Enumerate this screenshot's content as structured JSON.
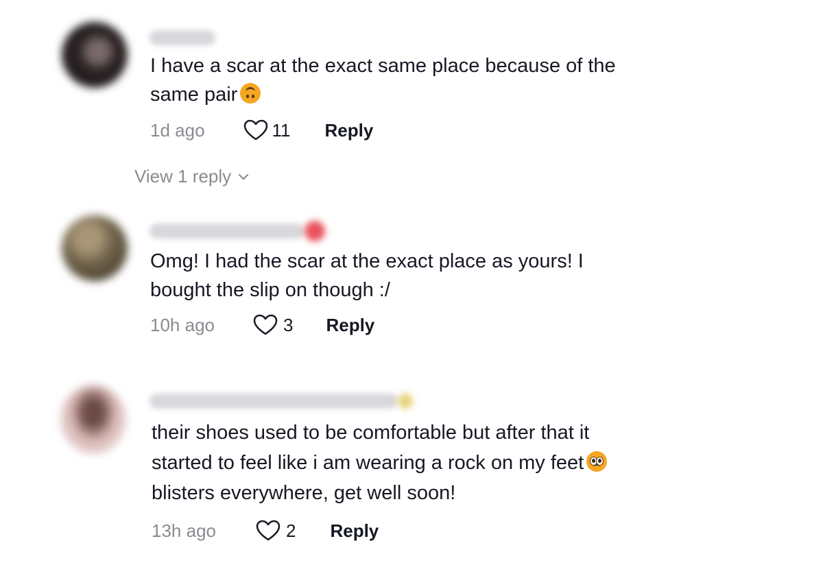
{
  "comments": [
    {
      "text": "I have a scar at the exact same place because of the\nsame pair",
      "emoji": "upside-down-face",
      "timestamp": "1d ago",
      "likes": "11",
      "reply_label": "Reply"
    },
    {
      "text": "Omg! I had the scar at the exact place as yours! I\nbought the slip on though :/",
      "timestamp": "10h ago",
      "likes": "3",
      "reply_label": "Reply"
    },
    {
      "text": "their shoes used to be comfortable but after that it\nstarted to feel like i am wearing a rock on my feet",
      "emoji": "pleading-face",
      "text_after_emoji": "blisters everywhere, get well soon!",
      "timestamp": "13h ago",
      "likes": "2",
      "reply_label": "Reply"
    }
  ],
  "view_replies": {
    "label": "View 1 reply"
  },
  "colors": {
    "text": "#161823",
    "muted": "#8a8b91",
    "emoji": "#f5a623"
  }
}
